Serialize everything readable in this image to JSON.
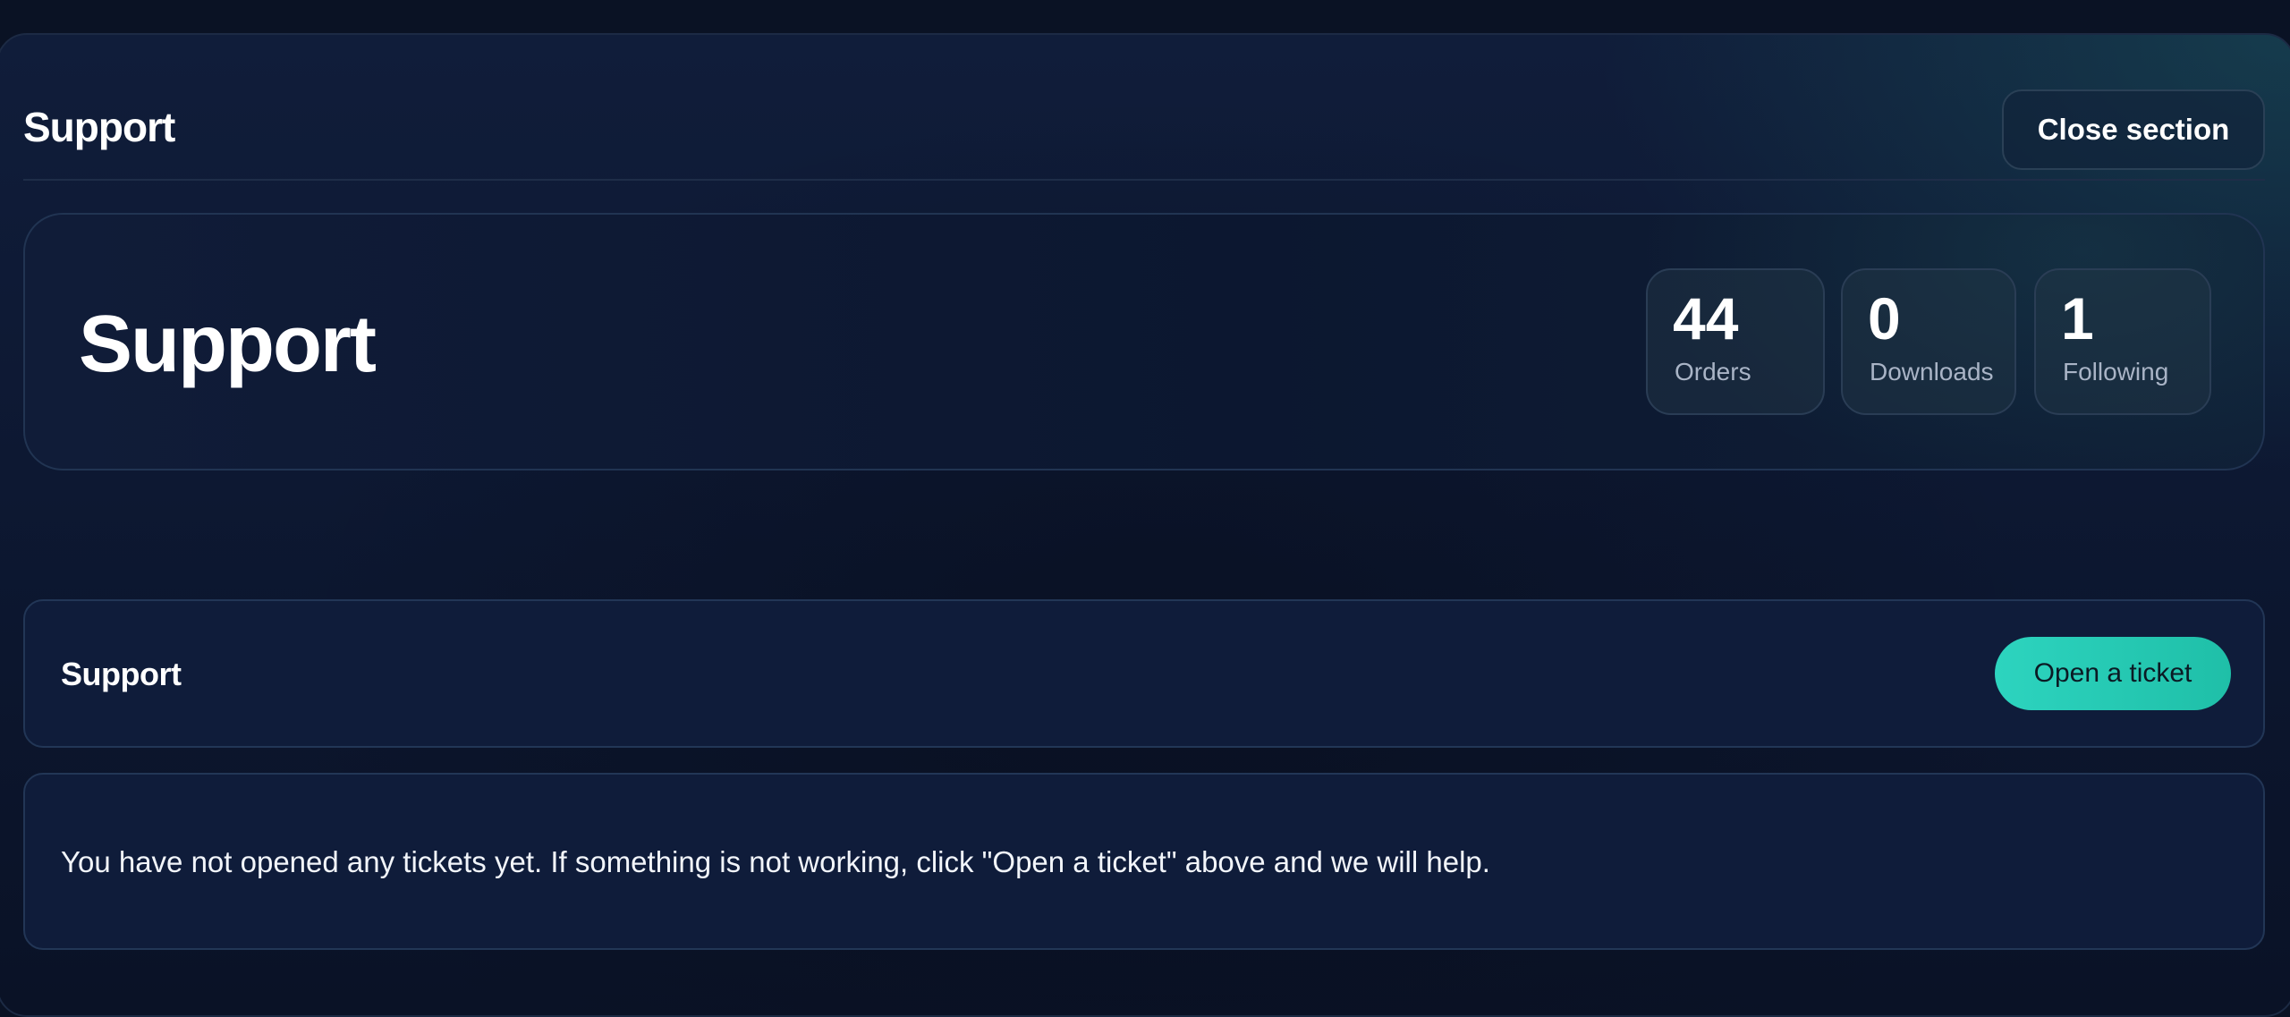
{
  "header": {
    "title": "Support",
    "close_label": "Close section"
  },
  "hero": {
    "title": "Support",
    "stats": [
      {
        "value": "44",
        "label": "Orders"
      },
      {
        "value": "0",
        "label": "Downloads"
      },
      {
        "value": "1",
        "label": "Following"
      }
    ]
  },
  "support_card": {
    "title": "Support",
    "open_ticket_label": "Open a ticket"
  },
  "tickets": {
    "empty_message": "You have not opened any tickets yet. If something is not working, click \"Open a ticket\" above and we will help."
  },
  "colors": {
    "accent": "#2dd4bf",
    "background": "#0a1224",
    "card": "#0f1c3a"
  }
}
